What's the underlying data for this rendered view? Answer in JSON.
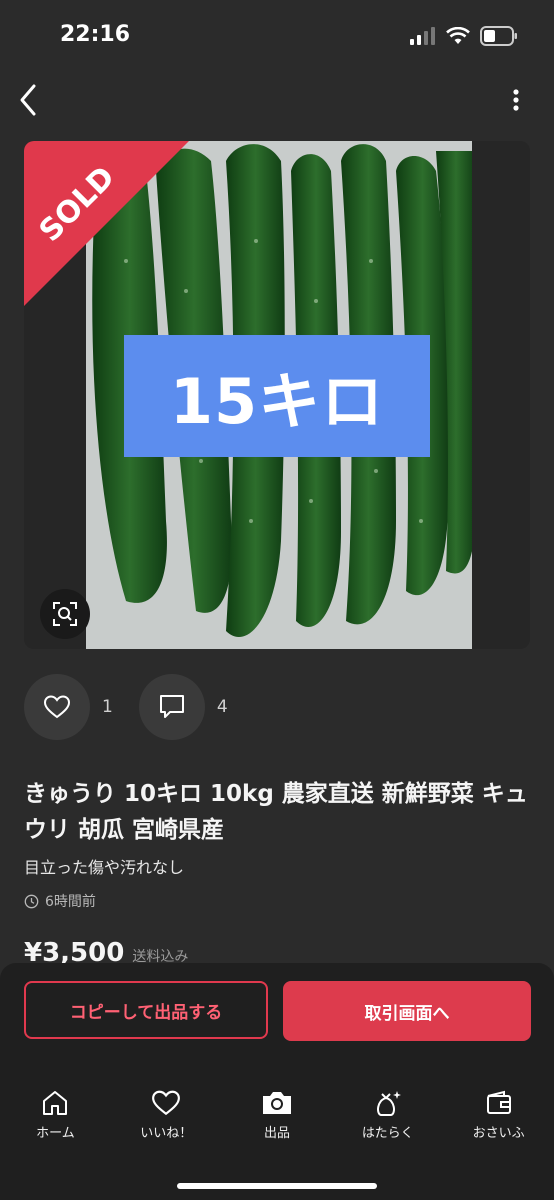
{
  "status": {
    "time": "22:16"
  },
  "item": {
    "sold_label": "SOLD",
    "overlay_text": "15キロ",
    "likes": "1",
    "comments": "4",
    "title": "きゅうり 10キロ 10kg 農家直送 新鮮野菜 キュウリ 胡瓜 宮崎県産",
    "condition": "目立った傷や汚れなし",
    "posted": "6時間前",
    "price": "¥3,500",
    "shipping": "送料込み"
  },
  "buttons": {
    "copy": "コピーして出品する",
    "trade": "取引画面へ"
  },
  "tabs": [
    {
      "label": "ホーム",
      "icon": "home-icon"
    },
    {
      "label": "いいね！",
      "icon": "heart-icon"
    },
    {
      "label": "出品",
      "icon": "camera-icon"
    },
    {
      "label": "はたらく",
      "icon": "bag-icon"
    },
    {
      "label": "おさいふ",
      "icon": "wallet-icon"
    }
  ],
  "colors": {
    "accent": "#dd3b4d",
    "overlay": "#5c8dee",
    "background": "#2b2b2b"
  }
}
